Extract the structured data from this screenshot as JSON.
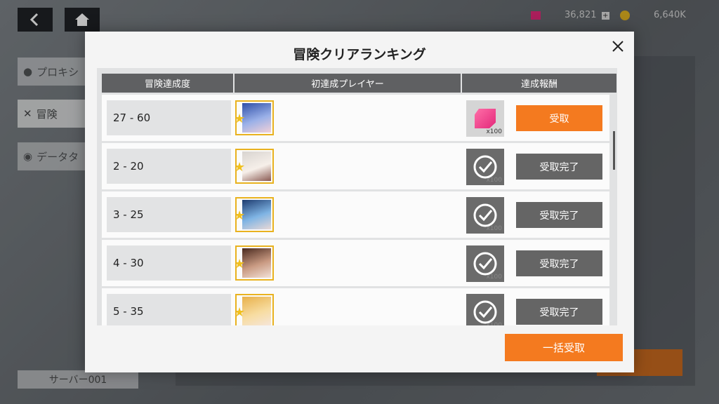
{
  "background": {
    "sidebar": {
      "items": [
        {
          "label": "プロキシ",
          "icon": "proxy-icon"
        },
        {
          "label": "冒険",
          "icon": "crossed-swords-icon"
        },
        {
          "label": "データタ",
          "icon": "database-icon"
        }
      ]
    },
    "server_label": "サーバー001",
    "currency": {
      "gems": "36,821",
      "coins": "6,640K"
    }
  },
  "modal": {
    "title": "冒険クリアランキング",
    "columns": {
      "rank": "冒険達成度",
      "player": "初達成プレイヤー",
      "reward": "達成報酬"
    },
    "rows": [
      {
        "stage": "27 - 60",
        "reward_qty": "x100",
        "button": "受取",
        "status": "claimable"
      },
      {
        "stage": "2 - 20",
        "reward_qty": "x100",
        "button": "受取完了",
        "status": "claimed"
      },
      {
        "stage": "3 - 25",
        "reward_qty": "x100",
        "button": "受取完了",
        "status": "claimed"
      },
      {
        "stage": "4 - 30",
        "reward_qty": "x100",
        "button": "受取完了",
        "status": "claimed"
      },
      {
        "stage": "5 - 35",
        "reward_qty": "x100",
        "button": "受取完了",
        "status": "claimed"
      }
    ],
    "claim_all_button": "一括受取"
  },
  "colors": {
    "accent": "#f47a1f",
    "header": "#5f6062",
    "claimed": "#656565"
  }
}
